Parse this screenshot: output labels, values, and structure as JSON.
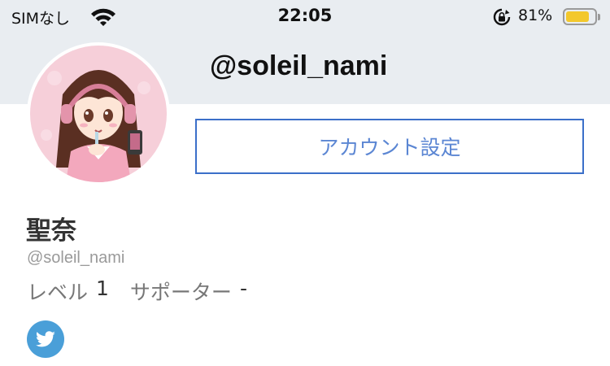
{
  "status_bar": {
    "carrier": "SIMなし",
    "time": "22:05",
    "battery_percent": "81%",
    "battery_level": 0.81,
    "battery_color": "#f3c82c",
    "icons": [
      "wifi-icon",
      "rotation-lock-icon",
      "battery-icon"
    ]
  },
  "header": {
    "handle": "@soleil_nami",
    "background_color": "#e9edf1"
  },
  "profile": {
    "avatar": "anime-girl-avatar",
    "settings_button_label": "アカウント設定",
    "display_name": "聖奈",
    "handle": "@soleil_nami",
    "level_label": "レベル",
    "level_value": "1",
    "supporter_label": "サポーター",
    "supporter_value": "-"
  },
  "social": {
    "twitter_icon": "twitter-bird-icon",
    "twitter_color": "#4a9fd8"
  },
  "colors": {
    "accent": "#3b6fc9",
    "button_text": "#5b86d3"
  }
}
